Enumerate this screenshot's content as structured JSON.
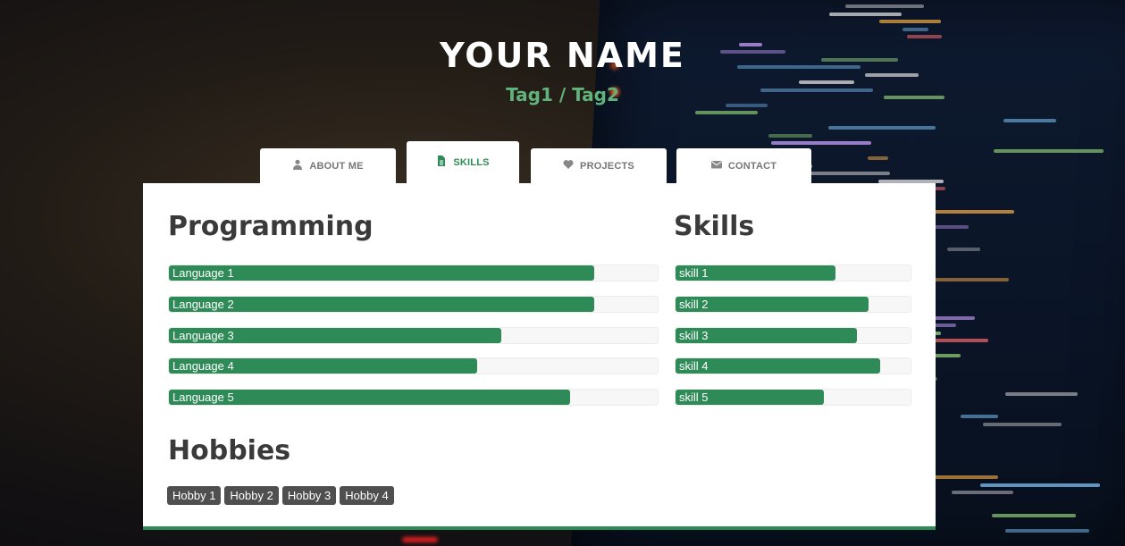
{
  "header": {
    "name": "YOUR NAME",
    "tags": "Tag1 / Tag2"
  },
  "tabs": [
    {
      "label": "ABOUT ME",
      "icon": "user-icon",
      "active": false
    },
    {
      "label": "SKILLS",
      "icon": "document-icon",
      "active": true
    },
    {
      "label": "PROJECTS",
      "icon": "heart-icon",
      "active": false
    },
    {
      "label": "CONTACT",
      "icon": "envelope-icon",
      "active": false
    }
  ],
  "programming": {
    "title": "Programming",
    "items": [
      {
        "label": "Language 1",
        "level": 0.87
      },
      {
        "label": "Language 2",
        "level": 0.87
      },
      {
        "label": "Language 3",
        "level": 0.68
      },
      {
        "label": "Language 4",
        "level": 0.63
      },
      {
        "label": "Language 5",
        "level": 0.82
      }
    ]
  },
  "skills": {
    "title": "Skills",
    "items": [
      {
        "label": "skill 1",
        "level": 0.68
      },
      {
        "label": "skill 2",
        "level": 0.82
      },
      {
        "label": "skill 3",
        "level": 0.77
      },
      {
        "label": "skill 4",
        "level": 0.87
      },
      {
        "label": "skill 5",
        "level": 0.63
      }
    ]
  },
  "hobbies": {
    "title": "Hobbies",
    "items": [
      "Hobby 1",
      "Hobby 2",
      "Hobby 3",
      "Hobby 4"
    ]
  },
  "colors": {
    "accent": "#2e8b57",
    "tag": "#5fb37b",
    "badge": "#4f4f4f",
    "heading": "#3a3a3a"
  }
}
